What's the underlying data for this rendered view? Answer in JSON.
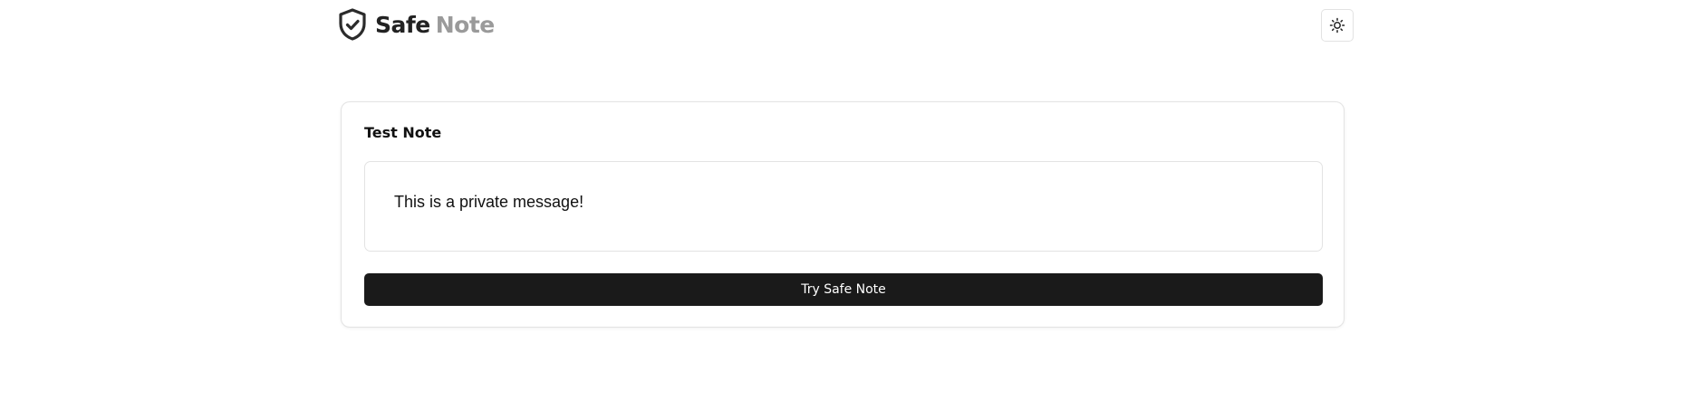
{
  "header": {
    "brand_primary": "Safe",
    "brand_secondary": "Note",
    "logo_icon": "shield-check-icon",
    "theme_toggle_icon": "sun-icon"
  },
  "note": {
    "title": "Test Note",
    "message": "This is a private message!",
    "cta_label": "Try Safe Note"
  },
  "colors": {
    "brand_primary": "#222222",
    "brand_secondary": "#9a9a9a",
    "button_bg": "#1a1a1a",
    "button_text": "#ffffff",
    "border": "#e3e3e3"
  }
}
